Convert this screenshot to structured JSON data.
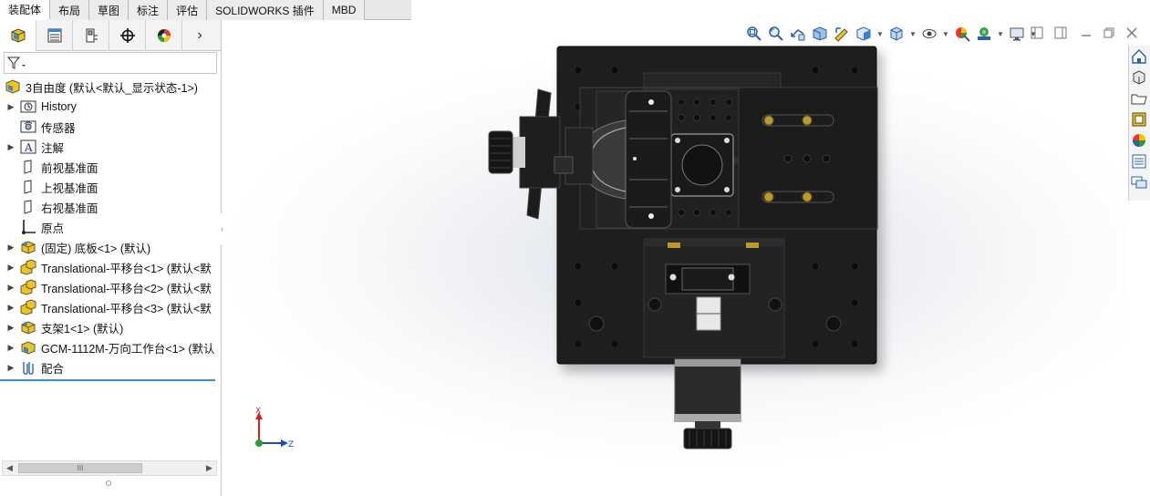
{
  "tabs": [
    {
      "label": "装配体",
      "active": true
    },
    {
      "label": "布局"
    },
    {
      "label": "草图"
    },
    {
      "label": "标注"
    },
    {
      "label": "评估"
    },
    {
      "label": "SOLIDWORKS 插件"
    },
    {
      "label": "MBD"
    }
  ],
  "panel": {
    "more_glyph": "›",
    "filter_icon": "filter-icon"
  },
  "tree": {
    "root": "3自由度  (默认<默认_显示状态-1>)",
    "items": [
      {
        "label": "History",
        "icon": "history-icon",
        "expander": true
      },
      {
        "label": "传感器",
        "icon": "sensor-icon",
        "expander": false
      },
      {
        "label": "注解",
        "icon": "annotation-icon",
        "expander": true
      },
      {
        "label": "前视基准面",
        "icon": "plane-icon",
        "expander": false
      },
      {
        "label": "上视基准面",
        "icon": "plane-icon",
        "expander": false
      },
      {
        "label": "右视基准面",
        "icon": "plane-icon",
        "expander": false
      },
      {
        "label": "原点",
        "icon": "origin-icon",
        "expander": false
      },
      {
        "label": "(固定) 底板<1> (默认)",
        "icon": "part-icon",
        "expander": true
      },
      {
        "label": "Translational-平移台<1> (默认<默",
        "icon": "subassembly-icon",
        "expander": true
      },
      {
        "label": "Translational-平移台<2> (默认<默",
        "icon": "subassembly-icon",
        "expander": true
      },
      {
        "label": "Translational-平移台<3> (默认<默",
        "icon": "subassembly-icon",
        "expander": true
      },
      {
        "label": "支架1<1> (默认)",
        "icon": "part-icon",
        "expander": true
      },
      {
        "label": "GCM-1112M-万向工作台<1> (默认",
        "icon": "subassembly-icon",
        "expander": true
      },
      {
        "label": "配合",
        "icon": "mates-icon",
        "expander": true
      }
    ]
  },
  "scrollbar": {
    "thumb_text": "III"
  },
  "triad": {
    "x_label": "X",
    "z_label": "Z"
  },
  "colors": {
    "accent": "#3d8fd1",
    "model_dark": "#1f1f1f",
    "axis_x": "#d42020",
    "axis_z": "#1f49c9"
  }
}
